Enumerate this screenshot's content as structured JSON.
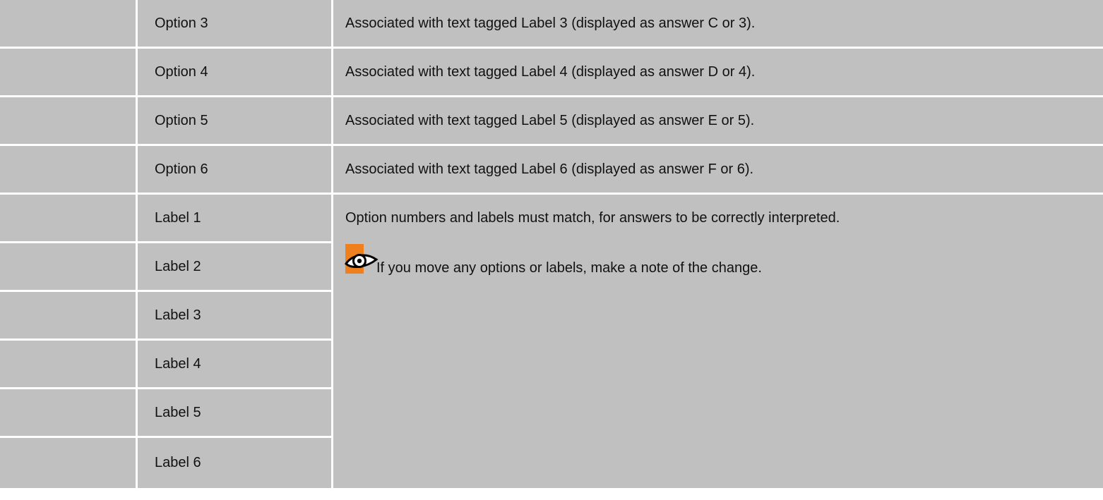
{
  "rows": [
    {
      "name": "Option 3",
      "description": "Associated with text tagged Label 3 (displayed as answer C or 3)."
    },
    {
      "name": "Option 4",
      "description": "Associated with text tagged Label 4 (displayed as answer D or 4)."
    },
    {
      "name": "Option 5",
      "description": "Associated with text tagged Label 5 (displayed as answer E or 5)."
    },
    {
      "name": "Option 6",
      "description": "Associated with text tagged Label 6 (displayed as answer F or 6)."
    }
  ],
  "labels": [
    "Label 1",
    "Label 2",
    "Label 3",
    "Label 4",
    "Label 5",
    "Label 6"
  ],
  "notes": {
    "line1": "Option numbers and labels must match, for answers to be correctly interpreted.",
    "line2": "If you move any options or labels, make a note of the change.",
    "icon": "eye-icon"
  },
  "colors": {
    "cell_background": "#c0c0c0",
    "icon_background": "#f07f1e"
  }
}
